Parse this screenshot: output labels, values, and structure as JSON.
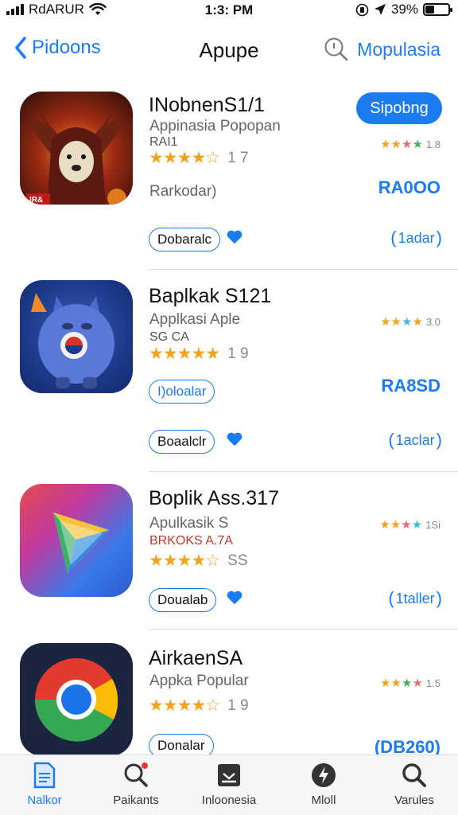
{
  "status_bar": {
    "carrier": "RdARUR",
    "time": "1:3: PM",
    "battery": "39%",
    "battery_level": 0.39
  },
  "nav": {
    "back_label": "Pidoons",
    "title": "Apupe",
    "right_label": "Mopulasia"
  },
  "apps": [
    {
      "name": "INobnenS1/1",
      "subtitle": "Appinasia Popopan",
      "subtitle2": "RAI1",
      "rating_stars": "★★★★☆",
      "rating_value": 3.5,
      "rating_count": "1 7",
      "mini_rating": "1.8",
      "action_button": "Sipobng",
      "meta": "Rarkodar)",
      "price": "RA0OO",
      "pill_label": "Dobaralc",
      "link_label": "1adar"
    },
    {
      "name": "Baplkak S121",
      "subtitle": "Applkasi Aple",
      "subtitle2": "SG CA",
      "rating_stars": "★★★★★",
      "rating_value": 4.5,
      "rating_count": "1 9",
      "mini_rating": "3.0",
      "pill_top": "I)oloalar",
      "price": "RA8SD",
      "pill_label": "Boaalclr",
      "link_label": "1aclar"
    },
    {
      "name": "Boplik Ass.317",
      "subtitle": "Apulkasik S",
      "subtitle2": "BRKOKS A.7A",
      "rating_stars": "★★★★☆",
      "rating_value": 4,
      "rating_count": "SS",
      "mini_rating": "1Si",
      "pill_label": "Doualab",
      "link_label": "1taller"
    },
    {
      "name": "AirkaenSA",
      "subtitle": "Appka Popular",
      "rating_stars": "★★★★☆",
      "rating_value": 3.5,
      "rating_count": "1 9",
      "mini_rating": "1.5",
      "pill_label": "Donalar",
      "price": "(DB260)"
    }
  ],
  "tabs": [
    {
      "label": "Nalkor",
      "icon": "document-icon",
      "active": true
    },
    {
      "label": "Paikants",
      "icon": "search-notification-icon",
      "active": false
    },
    {
      "label": "Inloonesia",
      "icon": "stack-icon",
      "active": false
    },
    {
      "label": "Mloll",
      "icon": "bolt-icon",
      "active": false
    },
    {
      "label": "Varules",
      "icon": "search-icon",
      "active": false
    }
  ],
  "colors": {
    "accent": "#1a7cf0",
    "star": "#f2a51c",
    "tab_bg": "#f6f6f8"
  }
}
